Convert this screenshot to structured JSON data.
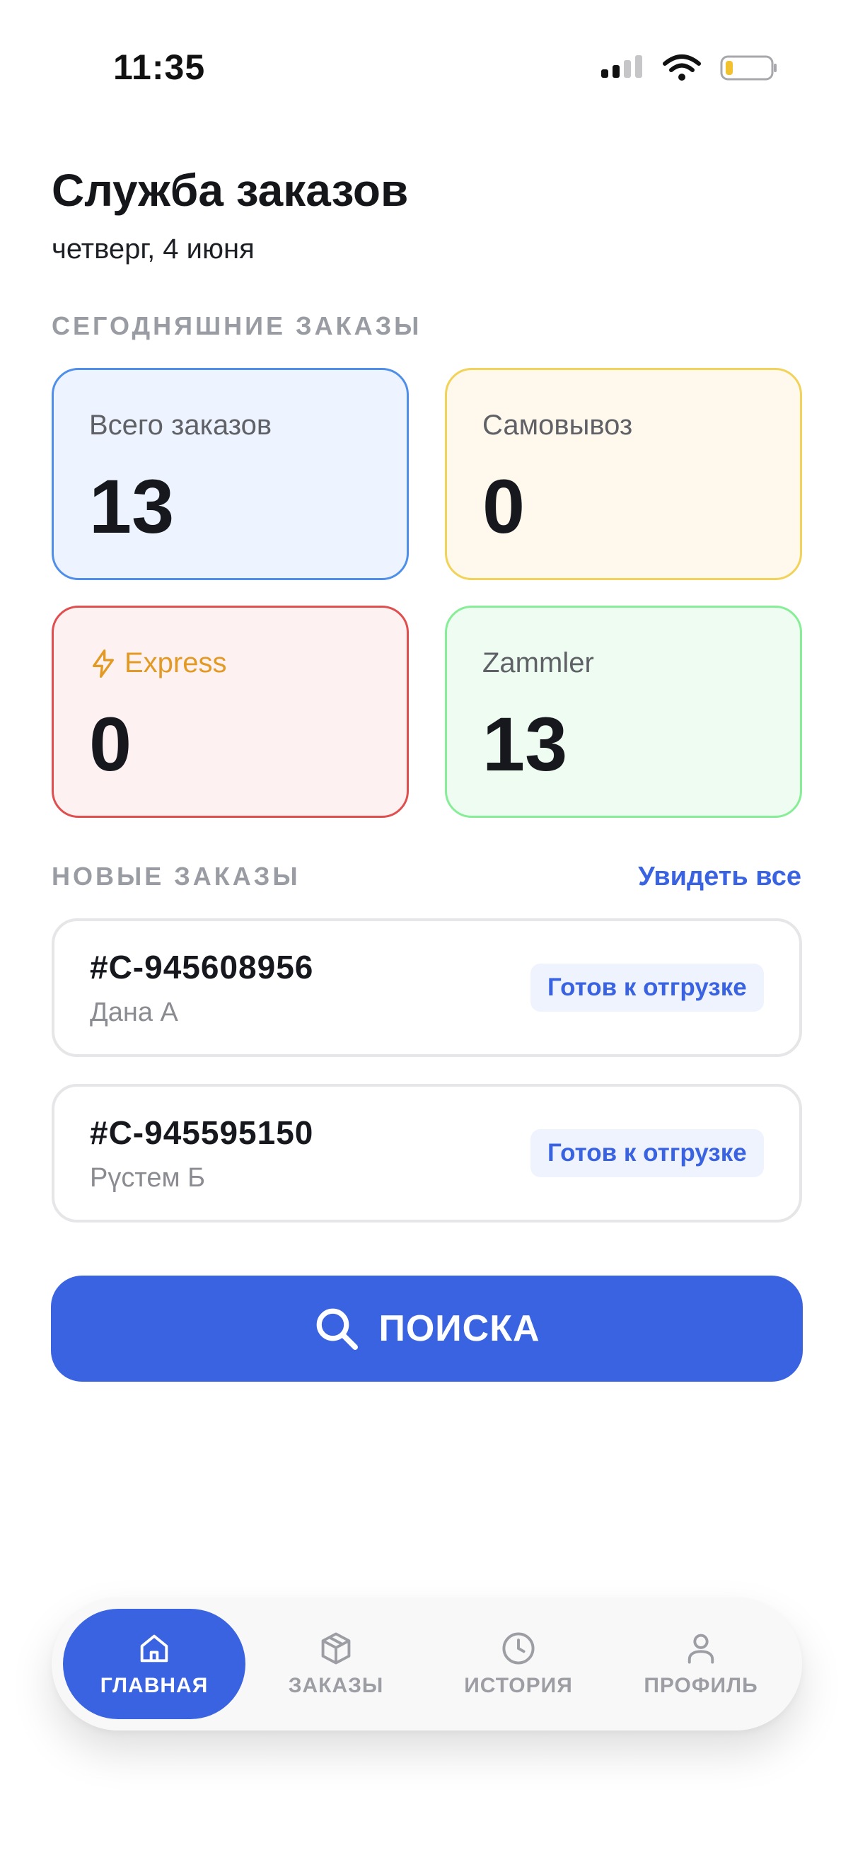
{
  "status_bar": {
    "time": "11:35"
  },
  "header": {
    "title": "Служба заказов",
    "date": "четверг, 4 июня"
  },
  "today_section": {
    "label": "СЕГОДНЯШНИЕ ЗАКАЗЫ",
    "cards": [
      {
        "label": "Всего заказов",
        "value": "13",
        "color": "#4f8fe9"
      },
      {
        "label": "Самовывоз",
        "value": "0",
        "color": "#f1d35a"
      },
      {
        "label": "Express",
        "value": "0",
        "color": "#e04f4f",
        "icon": "bolt-icon"
      },
      {
        "label": "Zammler",
        "value": "13",
        "color": "#86ee97"
      }
    ]
  },
  "new_orders": {
    "label": "НОВЫЕ ЗАКАЗЫ",
    "see_all": "Увидеть все",
    "items": [
      {
        "id": "#C-945608956",
        "customer": "Дана А",
        "status": "Готов к отгрузке"
      },
      {
        "id": "#C-945595150",
        "customer": "Рүстем Б",
        "status": "Готов к отгрузке"
      }
    ]
  },
  "search_button": {
    "label": "ПОИСКА",
    "icon": "search-icon"
  },
  "bottom_nav": {
    "items": [
      {
        "label": "ГЛАВНАЯ",
        "icon": "home-icon",
        "active": true
      },
      {
        "label": "ЗАКАЗЫ",
        "icon": "box-icon",
        "active": false
      },
      {
        "label": "ИСТОРИЯ",
        "icon": "clock-icon",
        "active": false
      },
      {
        "label": "ПРОФИЛЬ",
        "icon": "user-icon",
        "active": false
      }
    ]
  },
  "colors": {
    "accent": "#3a63e2",
    "express": "#e39a24"
  }
}
